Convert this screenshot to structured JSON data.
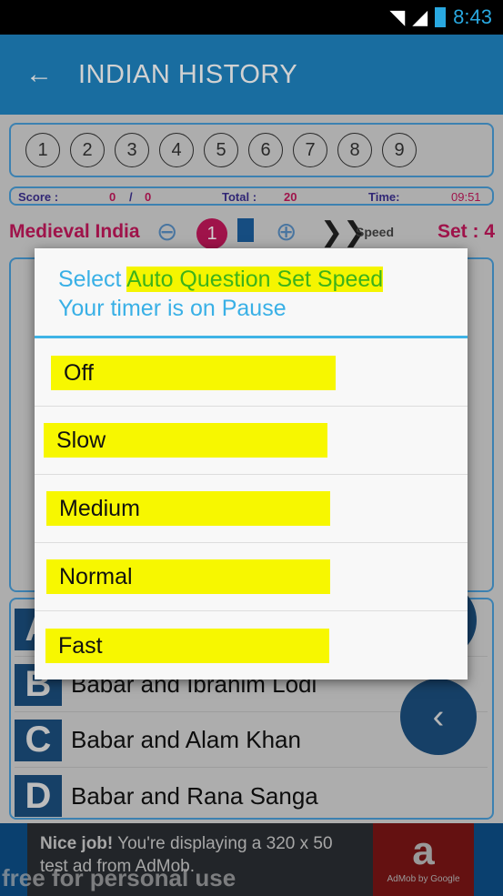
{
  "status_bar": {
    "time": "8:43",
    "icons": [
      "wifi-icon",
      "signal-icon",
      "battery-charging-icon"
    ]
  },
  "app_bar": {
    "title": "INDIAN HISTORY",
    "back_icon": "arrow-left-icon"
  },
  "question_numbers": [
    "1",
    "2",
    "3",
    "4",
    "5",
    "6",
    "7",
    "8",
    "9"
  ],
  "score_bar": {
    "score_label": "Score :",
    "score_value": "0",
    "separator": "/",
    "score_total": "0",
    "total_label": "Total :",
    "total_value": "20",
    "time_label": "Time:",
    "time_value": "09:51"
  },
  "toolbar": {
    "category": "Medieval India",
    "badge": "1",
    "speed_label": "Speed",
    "set_label": "Set : 4"
  },
  "options": [
    {
      "letter": "A",
      "text": ""
    },
    {
      "letter": "B",
      "text": "Babar and Ibrahim Lodi"
    },
    {
      "letter": "C",
      "text": "Babar and Alam Khan"
    },
    {
      "letter": "D",
      "text": "Babar and Rana Sanga"
    }
  ],
  "ad": {
    "bold": "Nice job!",
    "text": " You're displaying a 320 x 50 test ad from AdMob.",
    "logo_text": "AdMob by Google"
  },
  "watermark": "free for personal use",
  "dialog": {
    "title_prefix": "Select ",
    "title_highlight": "Auto Question Set Speed",
    "subtitle": "Your timer is on Pause",
    "items": [
      "Off",
      "Slow",
      "Medium",
      "Normal",
      "Fast"
    ]
  },
  "colors": {
    "app_bar": "#1f86c4",
    "accent": "#39b0e6",
    "highlight": "#f7f700",
    "option_letter_bg": "#1c4f7e",
    "category": "#c2185b"
  }
}
